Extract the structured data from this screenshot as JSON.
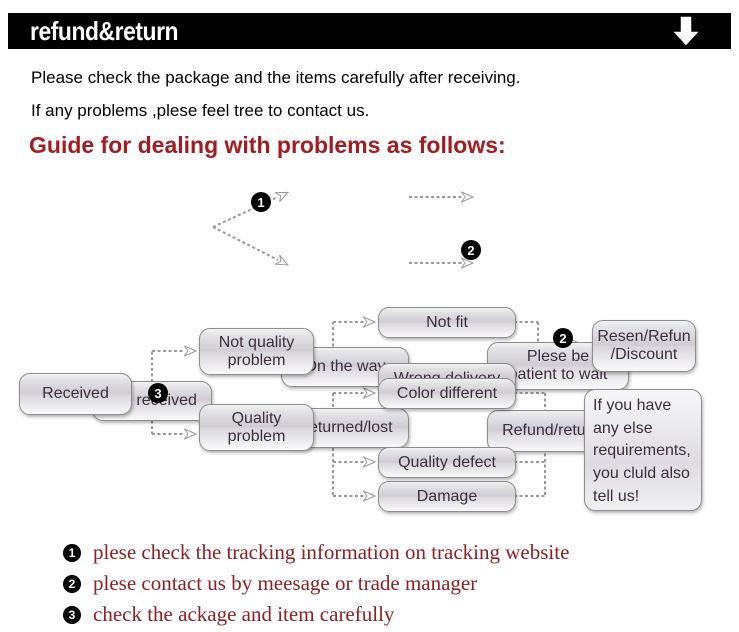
{
  "header": {
    "title": "refund&return",
    "arrow_icon": "arrow-down-icon",
    "background_color": "#000000",
    "text_color": "#ffffff"
  },
  "intro": {
    "line1": "Please check the package and the items carefully after receiving.",
    "line2": "If any problems ,plese feel tree to contact us."
  },
  "guide_heading": {
    "text": "Guide for dealing with problems as follows:",
    "color": "#a51c20"
  },
  "flow": {
    "section1": {
      "start": "Not received",
      "branch_top": "On the way",
      "branch_bottom": "Returned/lost",
      "result_top": "Plese be\npatient to wait",
      "result_top_line1": "Plese be",
      "result_top_line2": "patient to wait",
      "result_bottom": "Refund/return",
      "badge_top": "❶",
      "badge_top_number": "1",
      "badge_bottom": "❷",
      "badge_bottom_number": "2"
    },
    "section2": {
      "start": "Received",
      "badge_start": "❸",
      "badge_start_number": "3",
      "branch_top_line1": "Not quality",
      "branch_top_line2": "problem",
      "branch_bottom_line1": "Quality",
      "branch_bottom_line2": "problem",
      "leaves_top": [
        "Not fit",
        "Wrong delivery"
      ],
      "leaves_bottom": [
        "Color different",
        "Quality defect",
        "Damage"
      ],
      "result_line1": "Resen/Refun",
      "result_line2": "/Discount",
      "badge_result": "❷",
      "badge_result_number": "2",
      "note_line1": "If you have",
      "note_line2": "any else",
      "note_line3": "requirements,",
      "note_line4": "you cluld also",
      "note_line5": "tell us!"
    }
  },
  "bottom_list": {
    "color": "#8e2022",
    "items": [
      {
        "num": "1",
        "text": "plese check the tracking information on tracking website"
      },
      {
        "num": "2",
        "text": "plese contact us by meesage or trade manager"
      },
      {
        "num": "3",
        "text": "check the ackage and item carefully"
      }
    ]
  }
}
